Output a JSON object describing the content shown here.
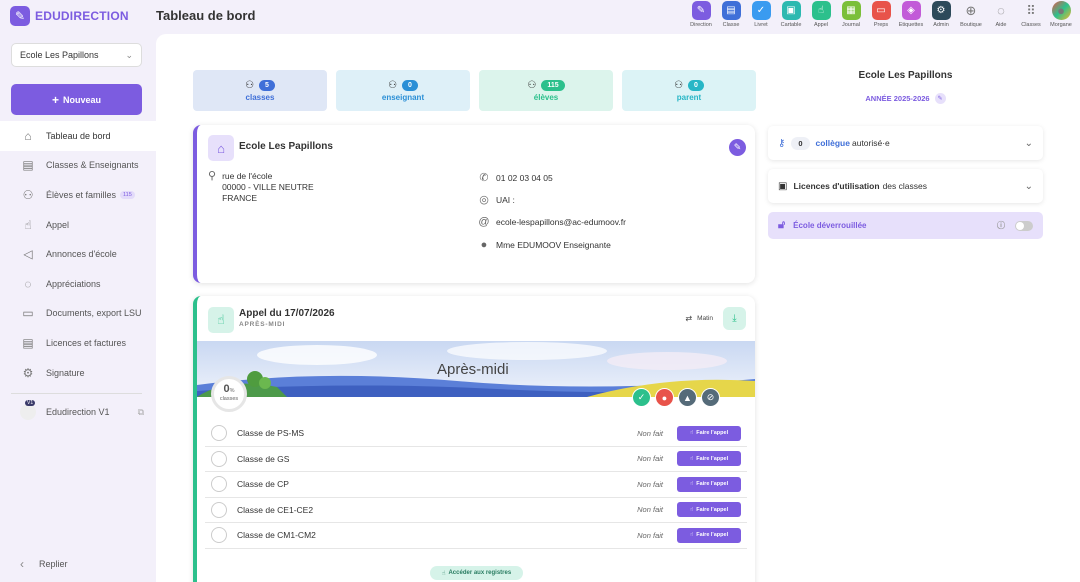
{
  "app": {
    "logo_text": "EDUDIRECTION",
    "page_title": "Tableau de bord"
  },
  "apps": [
    {
      "label": "Direction",
      "color": "#7c5ce0",
      "icon": "pencil-icon"
    },
    {
      "label": "Classe",
      "color": "#3f6fd8",
      "icon": "board-icon"
    },
    {
      "label": "Livret",
      "color": "#3a9bf0",
      "icon": "check-icon"
    },
    {
      "label": "Cartable",
      "color": "#2cb9b0",
      "icon": "briefcase-icon"
    },
    {
      "label": "Appel",
      "color": "#2cc08c",
      "icon": "hand-icon"
    },
    {
      "label": "Journal",
      "color": "#7bbf3a",
      "icon": "calendar-icon"
    },
    {
      "label": "Preps",
      "color": "#e8534a",
      "icon": "document-icon"
    },
    {
      "label": "Etiquettes",
      "color": "#c25bd8",
      "icon": "label-icon"
    },
    {
      "label": "Admin",
      "color": "#2d4a5a",
      "icon": "gear-icon"
    },
    {
      "label": "Boutique",
      "color": "",
      "icon": "cart-icon"
    },
    {
      "label": "Aide",
      "color": "",
      "icon": "chat-icon"
    },
    {
      "label": "Classes",
      "color": "",
      "icon": "grid-icon"
    },
    {
      "label": "Morgane",
      "color": "",
      "icon": "avatar-icon"
    }
  ],
  "sidebar": {
    "school_select": "Ecole Les Papillons",
    "new_button": "Nouveau",
    "items": [
      {
        "label": "Tableau de bord",
        "icon": "home-icon",
        "active": true
      },
      {
        "label": "Classes & Enseignants",
        "icon": "board-icon"
      },
      {
        "label": "Élèves et familles",
        "icon": "family-icon",
        "badge": "115"
      },
      {
        "label": "Appel",
        "icon": "hand-icon"
      },
      {
        "label": "Annonces d'école",
        "icon": "megaphone-icon"
      },
      {
        "label": "Appréciations",
        "icon": "chat-icon"
      },
      {
        "label": "Documents, export LSU",
        "icon": "folder-icon"
      },
      {
        "label": "Licences et factures",
        "icon": "license-icon"
      },
      {
        "label": "Signature",
        "icon": "gear-icon"
      }
    ],
    "v1_label": "Edudirection V1",
    "v1_badge": "V1",
    "replier": "Replier"
  },
  "stats": [
    {
      "value": "5",
      "label": "classes",
      "bg": "#dfe7f6",
      "pill": "#3f6fd8",
      "text": "#3f6fd8"
    },
    {
      "value": "0",
      "label": "enseignant",
      "bg": "#def0f8",
      "pill": "#2b8fd6",
      "text": "#2b8fd6"
    },
    {
      "value": "115",
      "label": "élèves",
      "bg": "#dcf4ec",
      "pill": "#2cc08c",
      "text": "#2cc08c"
    },
    {
      "value": "0",
      "label": "parent",
      "bg": "#dcf3f6",
      "pill": "#27b6c6",
      "text": "#27b6c6"
    }
  ],
  "school": {
    "name": "Ecole Les Papillons",
    "address": [
      "rue de l'école",
      "00000 - VILLE NEUTRE",
      "FRANCE"
    ],
    "phone": "01 02 03 04 05",
    "uai": "UAI :",
    "email": "ecole-lespapillons@ac-edumoov.fr",
    "director": "Mme EDUMOOV Enseignante"
  },
  "appel": {
    "title": "Appel du 17/07/2026",
    "subtitle": "APRÈS-MIDI",
    "switch_label": "Matin",
    "banner_text": "Après-midi",
    "gauge_value": "0",
    "gauge_unit": "%",
    "gauge_label": "classes",
    "classes": [
      {
        "name": "Classe de PS-MS",
        "status": "Non fait",
        "button": "Faire l'appel"
      },
      {
        "name": "Classe de GS",
        "status": "Non fait",
        "button": "Faire l'appel"
      },
      {
        "name": "Classe de CP",
        "status": "Non fait",
        "button": "Faire l'appel"
      },
      {
        "name": "Classe de CE1-CE2",
        "status": "Non fait",
        "button": "Faire l'appel"
      },
      {
        "name": "Classe de CM1-CM2",
        "status": "Non fait",
        "button": "Faire l'appel"
      }
    ],
    "registres": "Accéder aux registres"
  },
  "right": {
    "title": "Ecole Les Papillons",
    "year": "ANNÉE 2025-2026",
    "collegue_count": "0",
    "collegue_label": "collègue",
    "collegue_suffix": "autorisé·e",
    "licences_bold": "Licences d'utilisation",
    "licences_rest": "des classes",
    "unlocked": "École déverrouillée"
  }
}
